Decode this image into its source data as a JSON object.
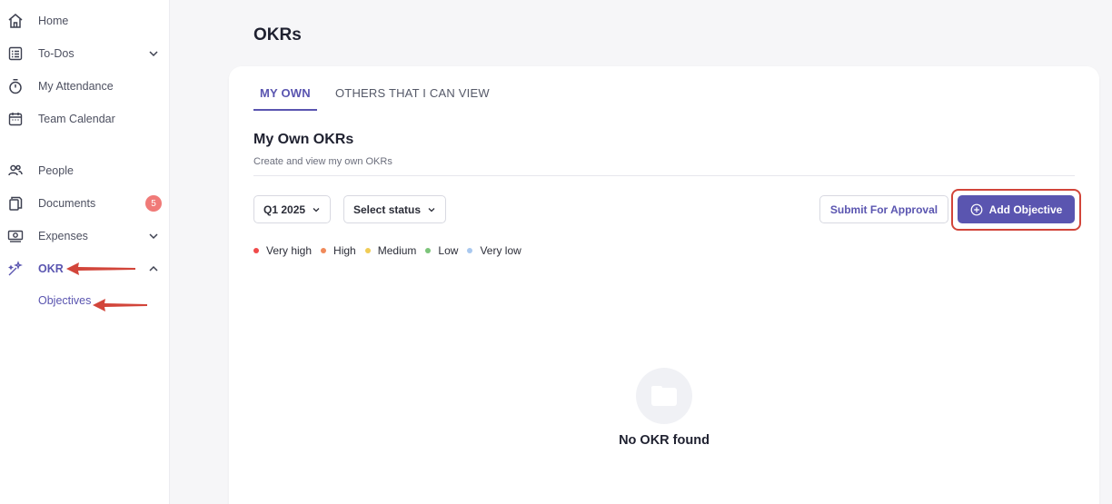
{
  "sidebar": {
    "items": [
      {
        "label": "Home",
        "icon": "home-icon"
      },
      {
        "label": "To-Dos",
        "icon": "checklist-icon"
      },
      {
        "label": "My Attendance",
        "icon": "stopwatch-icon"
      },
      {
        "label": "Team Calendar",
        "icon": "calendar-icon"
      },
      {
        "label": "People",
        "icon": "people-icon"
      },
      {
        "label": "Documents",
        "icon": "documents-icon",
        "badge": "5"
      },
      {
        "label": "Expenses",
        "icon": "money-icon"
      },
      {
        "label": "OKR",
        "icon": "wand-icon"
      }
    ],
    "sub_items": [
      {
        "label": "Objectives"
      }
    ]
  },
  "page": {
    "title": "OKRs"
  },
  "tabs": [
    {
      "label": "MY OWN",
      "active": true
    },
    {
      "label": "OTHERS THAT I CAN VIEW",
      "active": false
    }
  ],
  "section": {
    "title": "My Own OKRs",
    "subtitle": "Create and view my own OKRs"
  },
  "filters": {
    "quarter": "Q1 2025",
    "status": "Select status"
  },
  "actions": {
    "submit": "Submit For Approval",
    "add": "Add Objective"
  },
  "legend": [
    {
      "label": "Very high",
      "color": "#f04a4a"
    },
    {
      "label": "High",
      "color": "#f08a5a"
    },
    {
      "label": "Medium",
      "color": "#f0cc55"
    },
    {
      "label": "Low",
      "color": "#7cc47a"
    },
    {
      "label": "Very low",
      "color": "#a9c8ef"
    }
  ],
  "empty_state": {
    "message": "No OKR found"
  },
  "colors": {
    "accent": "#5a55b0",
    "annotation": "#d2453a"
  }
}
